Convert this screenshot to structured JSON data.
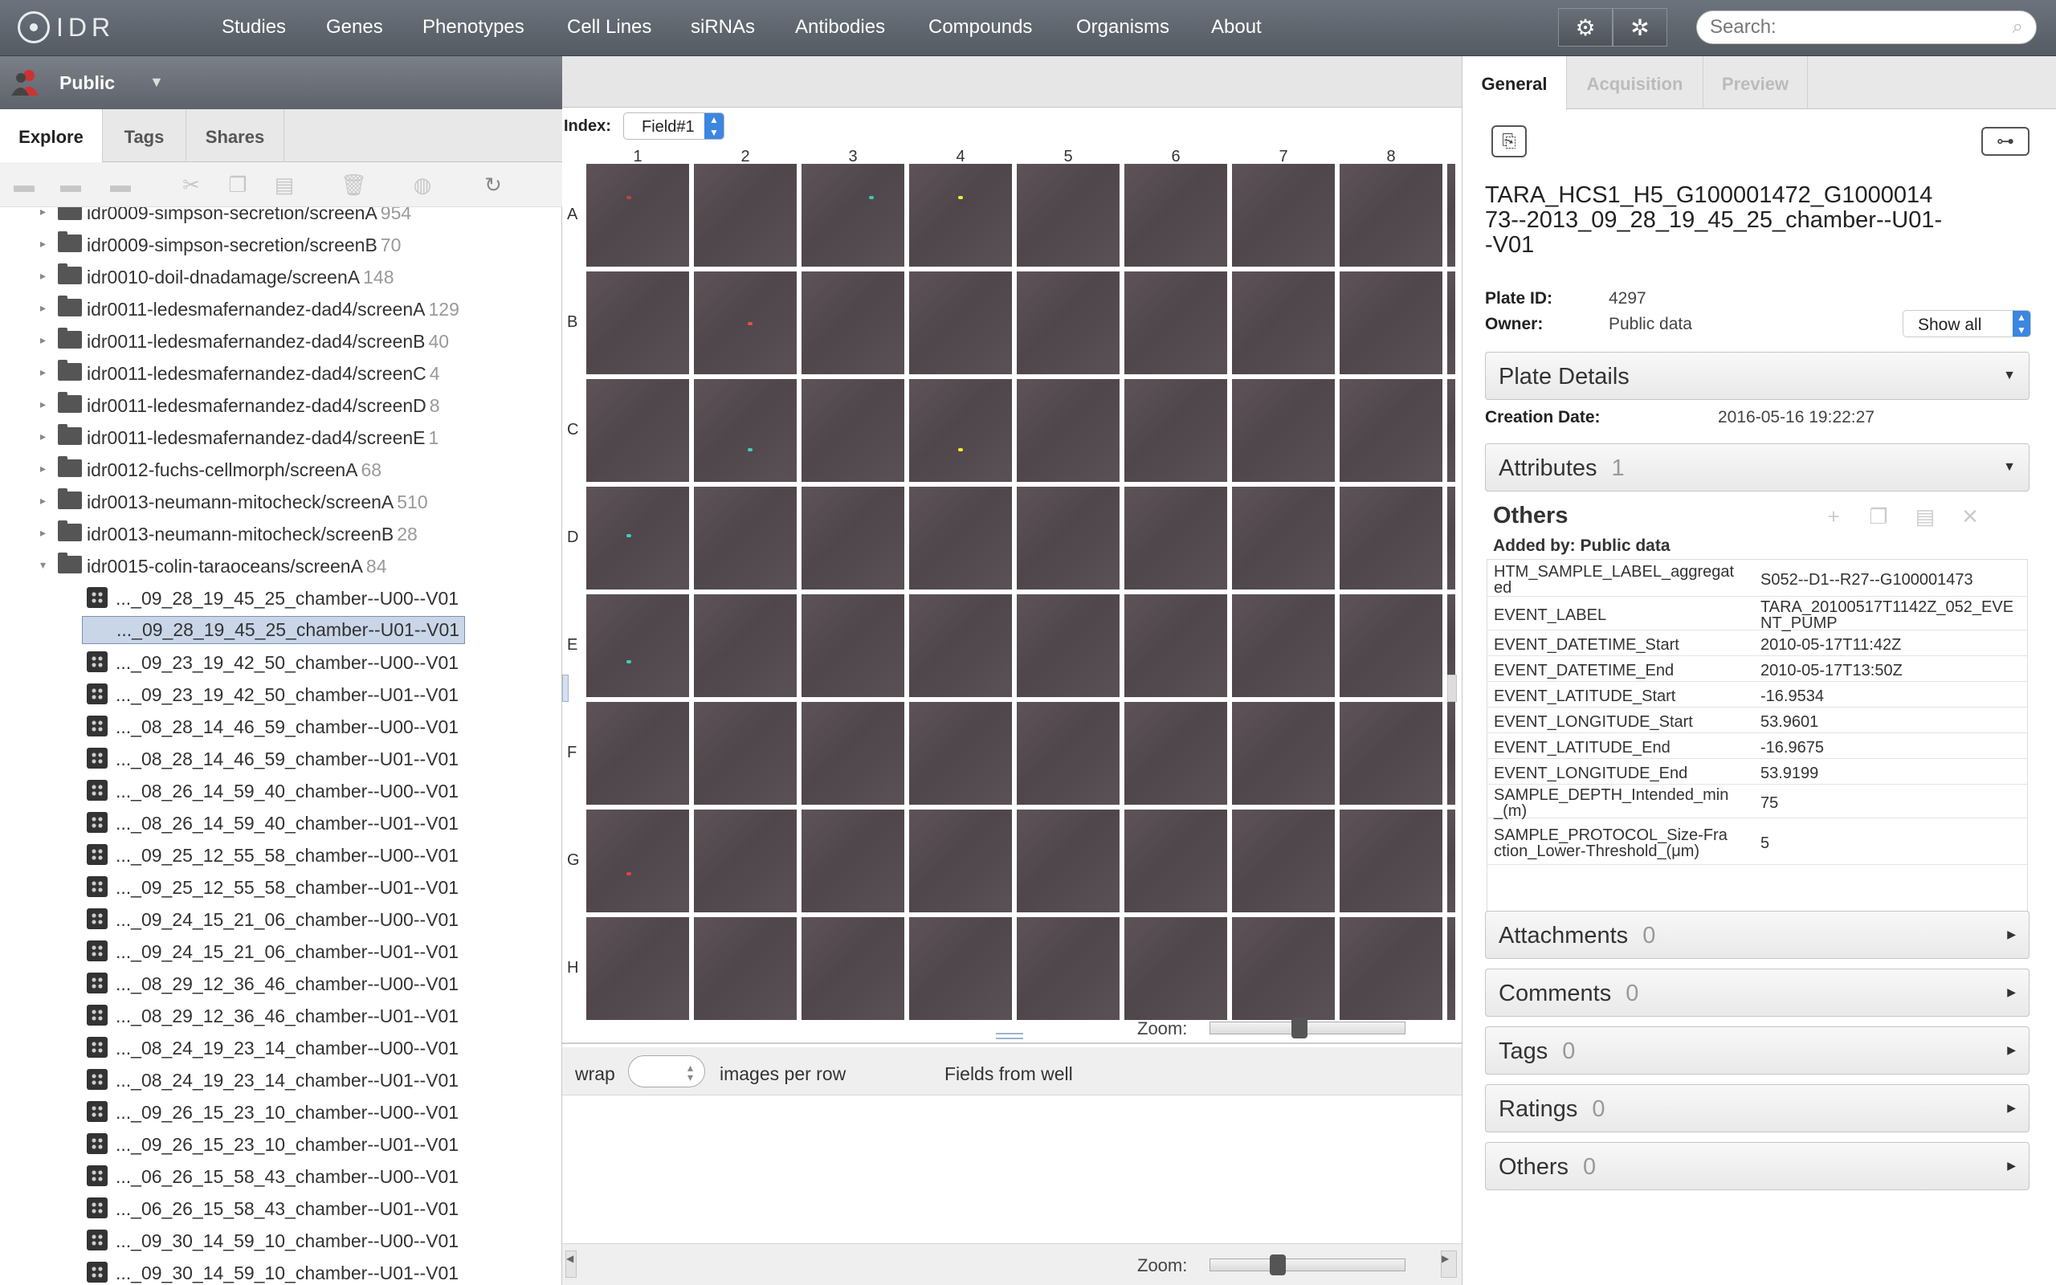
{
  "nav": {
    "logo": "IDR",
    "links": [
      "Studies",
      "Genes",
      "Phenotypes",
      "Cell Lines",
      "siRNAs",
      "Antibodies",
      "Compounds",
      "Organisms",
      "About"
    ],
    "search_placeholder": "Search:"
  },
  "left": {
    "user": "Public",
    "tabs": [
      "Explore",
      "Tags",
      "Shares"
    ],
    "tree": [
      {
        "label": "idr0009-simpson-secretion/screenA",
        "count": "954",
        "type": "folder"
      },
      {
        "label": "idr0009-simpson-secretion/screenB",
        "count": "70",
        "type": "folder"
      },
      {
        "label": "idr0010-doil-dnadamage/screenA",
        "count": "148",
        "type": "folder"
      },
      {
        "label": "idr0011-ledesmafernandez-dad4/screenA",
        "count": "129",
        "type": "folder"
      },
      {
        "label": "idr0011-ledesmafernandez-dad4/screenB",
        "count": "40",
        "type": "folder"
      },
      {
        "label": "idr0011-ledesmafernandez-dad4/screenC",
        "count": "4",
        "type": "folder"
      },
      {
        "label": "idr0011-ledesmafernandez-dad4/screenD",
        "count": "8",
        "type": "folder"
      },
      {
        "label": "idr0011-ledesmafernandez-dad4/screenE",
        "count": "1",
        "type": "folder"
      },
      {
        "label": "idr0012-fuchs-cellmorph/screenA",
        "count": "68",
        "type": "folder"
      },
      {
        "label": "idr0013-neumann-mitocheck/screenA",
        "count": "510",
        "type": "folder"
      },
      {
        "label": "idr0013-neumann-mitocheck/screenB",
        "count": "28",
        "type": "folder"
      },
      {
        "label": "idr0015-colin-taraoceans/screenA",
        "count": "84",
        "type": "folder-open"
      },
      {
        "label": "..._09_28_19_45_25_chamber--U00--V01",
        "count": "",
        "type": "plate"
      },
      {
        "label": "..._09_28_19_45_25_chamber--U01--V01",
        "count": "",
        "type": "plate-selected"
      },
      {
        "label": "..._09_23_19_42_50_chamber--U00--V01",
        "count": "",
        "type": "plate"
      },
      {
        "label": "..._09_23_19_42_50_chamber--U01--V01",
        "count": "",
        "type": "plate"
      },
      {
        "label": "..._08_28_14_46_59_chamber--U00--V01",
        "count": "",
        "type": "plate"
      },
      {
        "label": "..._08_28_14_46_59_chamber--U01--V01",
        "count": "",
        "type": "plate"
      },
      {
        "label": "..._08_26_14_59_40_chamber--U00--V01",
        "count": "",
        "type": "plate"
      },
      {
        "label": "..._08_26_14_59_40_chamber--U01--V01",
        "count": "",
        "type": "plate"
      },
      {
        "label": "..._09_25_12_55_58_chamber--U00--V01",
        "count": "",
        "type": "plate"
      },
      {
        "label": "..._09_25_12_55_58_chamber--U01--V01",
        "count": "",
        "type": "plate"
      },
      {
        "label": "..._09_24_15_21_06_chamber--U00--V01",
        "count": "",
        "type": "plate"
      },
      {
        "label": "..._09_24_15_21_06_chamber--U01--V01",
        "count": "",
        "type": "plate"
      },
      {
        "label": "..._08_29_12_36_46_chamber--U00--V01",
        "count": "",
        "type": "plate"
      },
      {
        "label": "..._08_29_12_36_46_chamber--U01--V01",
        "count": "",
        "type": "plate"
      },
      {
        "label": "..._08_24_19_23_14_chamber--U00--V01",
        "count": "",
        "type": "plate"
      },
      {
        "label": "..._08_24_19_23_14_chamber--U01--V01",
        "count": "",
        "type": "plate"
      },
      {
        "label": "..._09_26_15_23_10_chamber--U00--V01",
        "count": "",
        "type": "plate"
      },
      {
        "label": "..._09_26_15_23_10_chamber--U01--V01",
        "count": "",
        "type": "plate"
      },
      {
        "label": "..._06_26_15_58_43_chamber--U00--V01",
        "count": "",
        "type": "plate"
      },
      {
        "label": "..._06_26_15_58_43_chamber--U01--V01",
        "count": "",
        "type": "plate"
      },
      {
        "label": "..._09_30_14_59_10_chamber--U00--V01",
        "count": "",
        "type": "plate"
      },
      {
        "label": "..._09_30_14_59_10_chamber--U01--V01",
        "count": "",
        "type": "plate"
      }
    ]
  },
  "center": {
    "index_label": "Index:",
    "index_value": "Field#1",
    "columns": [
      "1",
      "2",
      "3",
      "4",
      "5",
      "6",
      "7",
      "8"
    ],
    "rows": [
      "A",
      "B",
      "C",
      "D",
      "E",
      "F",
      "G",
      "H"
    ],
    "zoom_label": "Zoom:",
    "zoom_level_top": 0.45,
    "zoom_level_bottom": 0.33,
    "wrap_label": "wrap",
    "images_per_row_label": "images per row",
    "fields_from_well": "Fields from well"
  },
  "right": {
    "tabs": [
      "General",
      "Acquisition",
      "Preview"
    ],
    "plate_title": "TARA_HCS1_H5_G100001472_G100001473--2013_09_28_19_45_25_chamber--U01--V01",
    "plate_id_label": "Plate ID:",
    "plate_id": "4297",
    "owner_label": "Owner:",
    "owner": "Public data",
    "show_all": "Show all",
    "plate_details": "Plate Details",
    "creation_date_label": "Creation Date:",
    "creation_date": "2016-05-16 19:22:27",
    "attributes": {
      "label": "Attributes",
      "count": "1"
    },
    "others_title": "Others",
    "added_by": "Added by: Public data",
    "map": [
      {
        "k": "HTM_SAMPLE_LABEL_aggregated",
        "v": "S052--D1--R27--G100001473"
      },
      {
        "k": "EVENT_LABEL",
        "v": "TARA_20100517T1142Z_052_EVENT_PUMP"
      },
      {
        "k": "EVENT_DATETIME_Start",
        "v": "2010-05-17T11:42Z"
      },
      {
        "k": "EVENT_DATETIME_End",
        "v": "2010-05-17T13:50Z"
      },
      {
        "k": "EVENT_LATITUDE_Start",
        "v": "-16.9534"
      },
      {
        "k": "EVENT_LONGITUDE_Start",
        "v": "53.9601"
      },
      {
        "k": "EVENT_LATITUDE_End",
        "v": "-16.9675"
      },
      {
        "k": "EVENT_LONGITUDE_End",
        "v": "53.9199"
      },
      {
        "k": "SAMPLE_DEPTH_Intended_min_(m)",
        "v": "75"
      },
      {
        "k": "SAMPLE_PROTOCOL_Size-Fraction_Lower-Threshold_(μm)",
        "v": "5"
      }
    ],
    "sections": [
      {
        "label": "Attachments",
        "count": "0"
      },
      {
        "label": "Comments",
        "count": "0"
      },
      {
        "label": "Tags",
        "count": "0"
      },
      {
        "label": "Ratings",
        "count": "0"
      },
      {
        "label": "Others",
        "count": "0"
      }
    ]
  }
}
